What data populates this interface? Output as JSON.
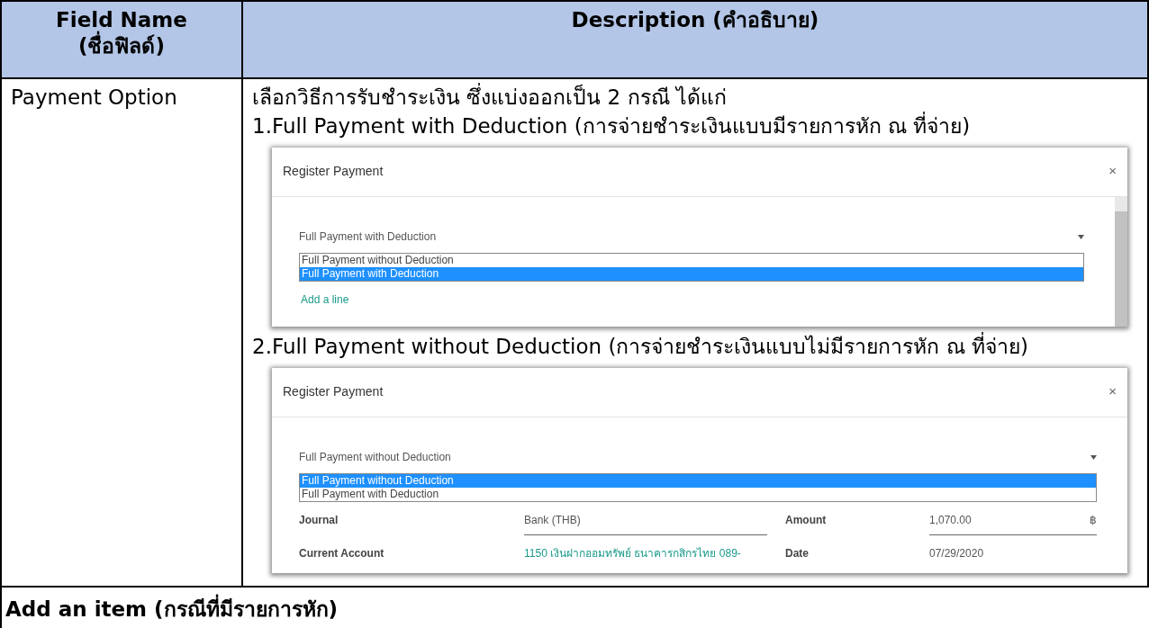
{
  "table": {
    "columns": [
      {
        "title": "Field Name",
        "subtitle": "(ชื่อฟิลด์)"
      },
      {
        "title": "Description (คำอธิบาย)"
      }
    ],
    "rows": [
      {
        "field": "Payment Option",
        "intro": "เลือกวิธีการรับชำระเงิน ซึ่งแบ่งออกเป็น 2 กรณี ได้แก่",
        "options": [
          {
            "text": "1.Full Payment with Deduction (การจ่ายชำระเงินแบบมีรายการหัก ณ ที่จ่าย)",
            "dialog": {
              "kind": "with_lines",
              "title": "Register Payment",
              "close": "×",
              "value": "Full Payment with Deduction",
              "choices": [
                {
                  "label": "Full Payment without Deduction",
                  "selected": false
                },
                {
                  "label": "Full Payment with Deduction",
                  "selected": true
                }
              ],
              "link": "Add a line"
            }
          },
          {
            "text": "2.Full Payment without Deduction (การจ่ายชำระเงินแบบไม่มีรายการหัก ณ ที่จ่าย)",
            "dialog": {
              "kind": "form",
              "title": "Register Payment",
              "close": "×",
              "value": "Full Payment without Deduction",
              "choices": [
                {
                  "label": "Full Payment without Deduction",
                  "selected": true
                },
                {
                  "label": "Full Payment with Deduction",
                  "selected": false
                }
              ],
              "fields": [
                {
                  "label": "Journal",
                  "value": "Bank (THB)",
                  "label2": "Amount",
                  "value2": "1,070.00",
                  "unit": "฿"
                },
                {
                  "label": "Current Account",
                  "value": "1150 เงินฝากออมทรัพย์ ธนาคารกสิกรไทย 089-",
                  "label2": "Date",
                  "value2": "07/29/2020"
                }
              ]
            }
          }
        ]
      }
    ],
    "section": "Add an item (กรณีที่มีรายการหัก)"
  }
}
